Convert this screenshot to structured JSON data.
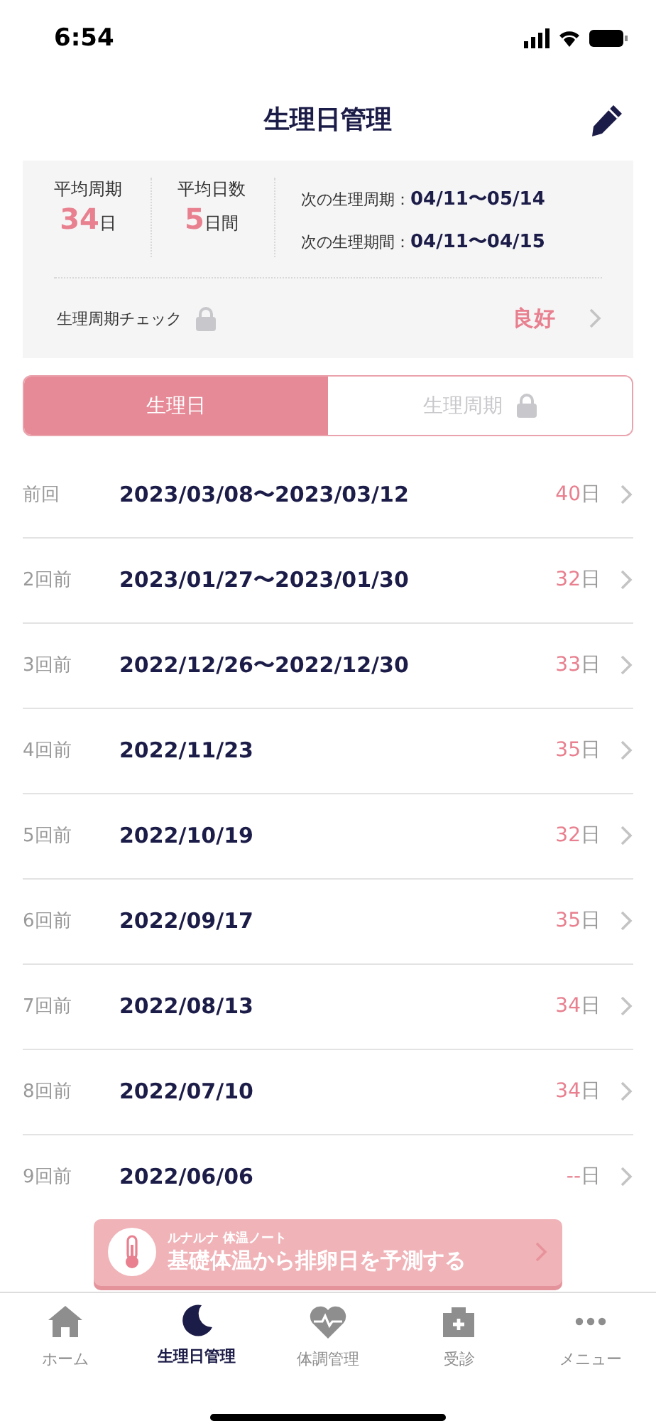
{
  "status_bar": {
    "time": "6:54"
  },
  "header": {
    "title": "生理日管理"
  },
  "summary": {
    "avg_cycle": {
      "label": "平均周期",
      "value": "34",
      "unit": "日"
    },
    "avg_days": {
      "label": "平均日数",
      "value": "5",
      "unit": "日間"
    },
    "next": [
      {
        "label": "次の生理周期：",
        "value": "04/11〜05/14"
      },
      {
        "label": "次の生理期間：",
        "value": "04/11〜04/15"
      }
    ],
    "check": {
      "label": "生理周期チェック",
      "locked": true,
      "result": "良好"
    }
  },
  "tabs": [
    {
      "label": "生理日",
      "selected": true,
      "locked": false
    },
    {
      "label": "生理周期",
      "selected": false,
      "locked": true
    }
  ],
  "records": [
    {
      "label": "前回",
      "dates": "2023/03/08〜2023/03/12",
      "days": "40",
      "unit": "日"
    },
    {
      "label": "2回前",
      "dates": "2023/01/27〜2023/01/30",
      "days": "32",
      "unit": "日"
    },
    {
      "label": "3回前",
      "dates": "2022/12/26〜2022/12/30",
      "days": "33",
      "unit": "日"
    },
    {
      "label": "4回前",
      "dates": "2022/11/23",
      "days": "35",
      "unit": "日"
    },
    {
      "label": "5回前",
      "dates": "2022/10/19",
      "days": "32",
      "unit": "日"
    },
    {
      "label": "6回前",
      "dates": "2022/09/17",
      "days": "35",
      "unit": "日"
    },
    {
      "label": "7回前",
      "dates": "2022/08/13",
      "days": "34",
      "unit": "日"
    },
    {
      "label": "8回前",
      "dates": "2022/07/10",
      "days": "34",
      "unit": "日"
    },
    {
      "label": "9回前",
      "dates": "2022/06/06",
      "days": "--",
      "unit": "日"
    }
  ],
  "banner": {
    "caption": "ルナルナ 体温ノート",
    "text": "基礎体温から排卵日を予測する"
  },
  "nav": [
    {
      "label": "ホーム",
      "kind": "home",
      "selected": false
    },
    {
      "label": "生理日管理",
      "kind": "moon",
      "selected": true
    },
    {
      "label": "体調管理",
      "kind": "heart",
      "selected": false
    },
    {
      "label": "受診",
      "kind": "clinic",
      "selected": false
    },
    {
      "label": "メニュー",
      "kind": "more",
      "selected": false
    }
  ]
}
